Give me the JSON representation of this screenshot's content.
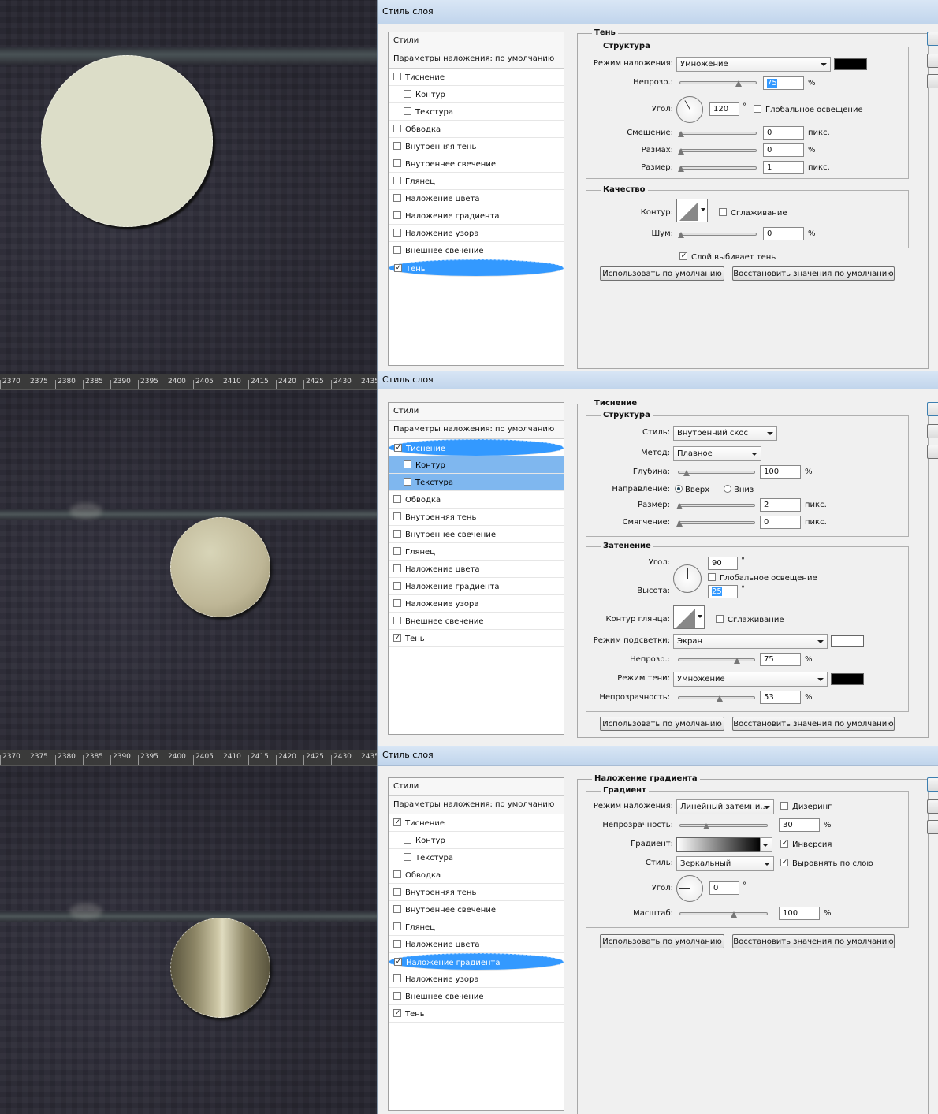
{
  "ruler_ticks": [
    "2370",
    "2375",
    "2380",
    "2385",
    "2390",
    "2395",
    "2400",
    "2405",
    "2410",
    "2415",
    "2420",
    "2425",
    "2430",
    "2435"
  ],
  "title": "Стиль слоя",
  "styles_list": {
    "header": "Стили",
    "blend": "Параметры наложения: по умолчанию",
    "items": [
      "Тиснение",
      "Контур",
      "Текстура",
      "Обводка",
      "Внутренняя тень",
      "Внутреннее свечение",
      "Глянец",
      "Наложение цвета",
      "Наложение градиента",
      "Наложение узора",
      "Внешнее свечение",
      "Тень"
    ]
  },
  "common": {
    "use_default": "Использовать по умолчанию",
    "restore_default": "Восстановить значения по умолчанию",
    "percent": "%",
    "px": "пикс.",
    "degree": "°"
  },
  "shadow": {
    "section": "Тень",
    "structure": "Структура",
    "blend_mode_label": "Режим наложения:",
    "blend_mode": "Умножение",
    "color": "#000000",
    "opacity_label": "Непрозр.:",
    "opacity": "75",
    "angle_label": "Угол:",
    "angle": "120",
    "global_light": "Глобальное освещение",
    "distance_label": "Смещение:",
    "distance": "0",
    "spread_label": "Размах:",
    "spread": "0",
    "size_label": "Размер:",
    "size": "1",
    "quality": "Качество",
    "contour_label": "Контур:",
    "antialias": "Сглаживание",
    "noise_label": "Шум:",
    "noise": "0",
    "knockout": "Слой выбивает тень"
  },
  "bevel": {
    "section": "Тиснение",
    "structure": "Структура",
    "style_label": "Стиль:",
    "style": "Внутренний скос",
    "method_label": "Метод:",
    "method": "Плавное",
    "depth_label": "Глубина:",
    "depth": "100",
    "direction_label": "Направление:",
    "up": "Вверх",
    "down": "Вниз",
    "size_label": "Размер:",
    "size": "2",
    "soften_label": "Смягчение:",
    "soften": "0",
    "shading": "Затенение",
    "angle_label": "Угол:",
    "angle": "90",
    "global_light": "Глобальное освещение",
    "altitude_label": "Высота:",
    "altitude": "25",
    "gloss_label": "Контур глянца:",
    "antialias": "Сглаживание",
    "hl_mode_label": "Режим подсветки:",
    "hl_mode": "Экран",
    "hl_color": "#ffffff",
    "hl_opacity_label": "Непрозр.:",
    "hl_opacity": "75",
    "sh_mode_label": "Режим тени:",
    "sh_mode": "Умножение",
    "sh_color": "#000000",
    "sh_opacity_label": "Непрозрачность:",
    "sh_opacity": "53"
  },
  "gradient": {
    "section": "Наложение градиента",
    "sub": "Градиент",
    "blend_mode_label": "Режим наложения:",
    "blend_mode": "Линейный затемни...",
    "dither": "Дизеринг",
    "opacity_label": "Непрозрачность:",
    "opacity": "30",
    "gradient_label": "Градиент:",
    "reverse": "Инверсия",
    "style_label": "Стиль:",
    "style": "Зеркальный",
    "align": "Выровнять по слою",
    "angle_label": "Угол:",
    "angle": "0",
    "scale_label": "Масштаб:",
    "scale": "100"
  }
}
